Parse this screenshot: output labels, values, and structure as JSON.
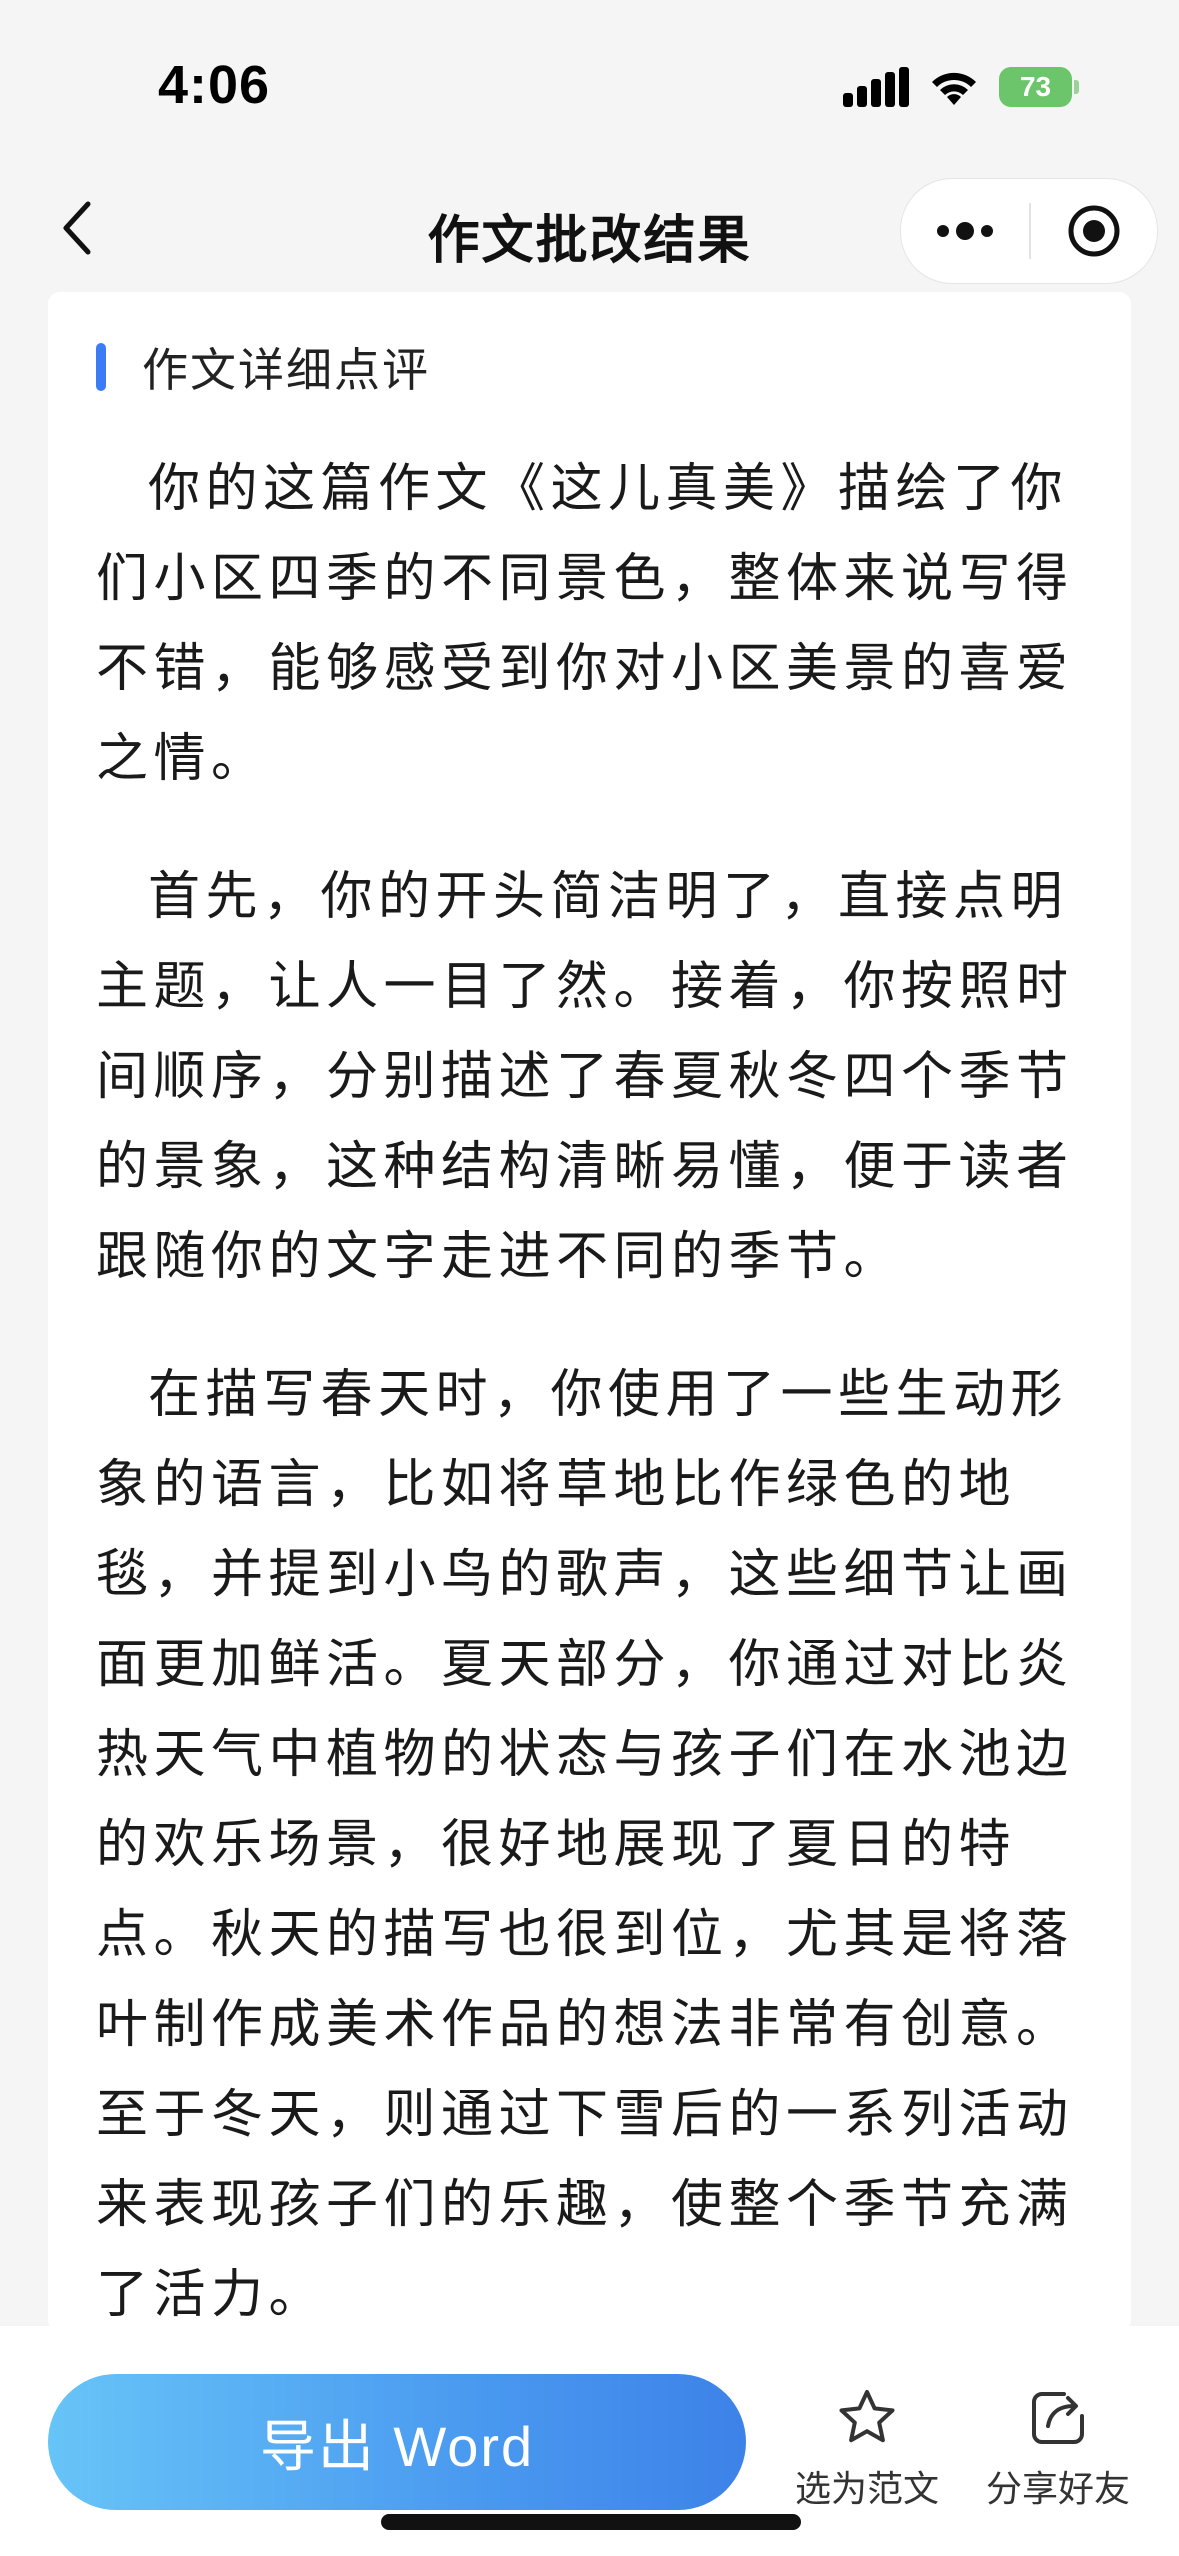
{
  "status_bar": {
    "time": "4:06",
    "battery_level": "73",
    "icons": [
      "signal-icon",
      "wifi-icon",
      "battery-charging-icon"
    ]
  },
  "nav": {
    "title": "作文批改结果",
    "icons": [
      "chevron-left-icon",
      "more-dots-icon",
      "target-close-icon"
    ]
  },
  "card": {
    "section_title": "作文详细点评",
    "accent_color": "#3b7cf6",
    "paragraphs": [
      "你的这篇作文《这儿真美》描绘了你们小区四季的不同景色，整体来说写得不错，能够感受到你对小区美景的喜爱之情。",
      "首先，你的开头简洁明了，直接点明主题，让人一目了然。接着，你按照时间顺序，分别描述了春夏秋冬四个季节的景象，这种结构清晰易懂，便于读者跟随你的文字走进不同的季节。",
      "在描写春天时，你使用了一些生动形象的语言，比如将草地比作绿色的地毯，并提到小鸟的歌声，这些细节让画面更加鲜活。夏天部分，你通过对比炎热天气中植物的状态与孩子们在水池边的欢乐场景，很好地展现了夏日的特点。秋天的描写也很到位，尤其是将落叶制作成美术作品的想法非常有创意。至于冬天，则通过下雪后的一系列活动来表现孩子们的乐趣，使整个季节充满了活力。"
    ]
  },
  "bottom_bar": {
    "export_label": "导出 Word",
    "favorite_label": "选为范文",
    "share_label": "分享好友",
    "export_gradient": [
      "#67c4f7",
      "#3d82e8"
    ],
    "icons": [
      "star-icon",
      "share-icon"
    ]
  }
}
